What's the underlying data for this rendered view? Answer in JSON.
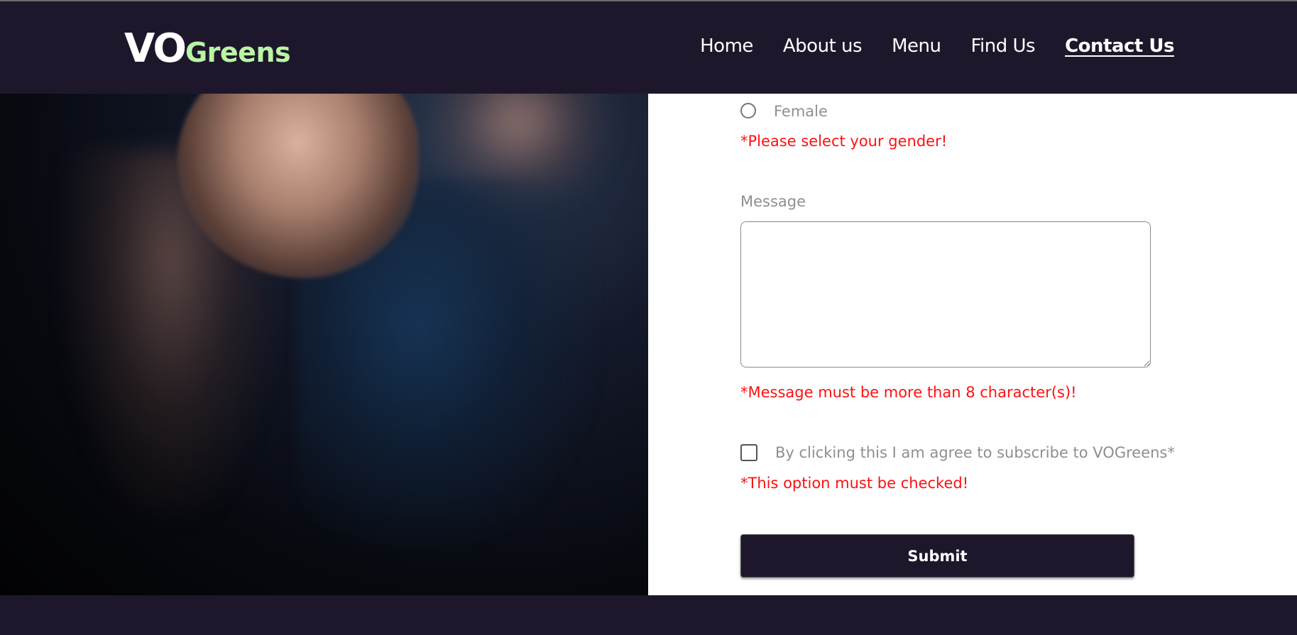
{
  "header": {
    "logo_vo": "VO",
    "logo_greens": "Greens",
    "nav": [
      {
        "label": "Home",
        "active": false
      },
      {
        "label": "About us",
        "active": false
      },
      {
        "label": "Menu",
        "active": false
      },
      {
        "label": "Find Us",
        "active": false
      },
      {
        "label": "Contact Us",
        "active": true
      }
    ]
  },
  "form": {
    "gender_option_label": "Female",
    "gender_error": "*Please select your gender!",
    "message_label": "Message",
    "message_value": "",
    "message_error": "*Message must be more than 8 character(s)!",
    "subscribe_label": "By clicking this I am agree to subscribe to VOGreens*",
    "subscribe_error": "*This option must be checked!",
    "submit_label": "Submit"
  },
  "colors": {
    "header_bg": "#1e172b",
    "logo_accent": "#b9f5a5",
    "error": "#ff1010",
    "muted_text": "#8f8f8f"
  }
}
